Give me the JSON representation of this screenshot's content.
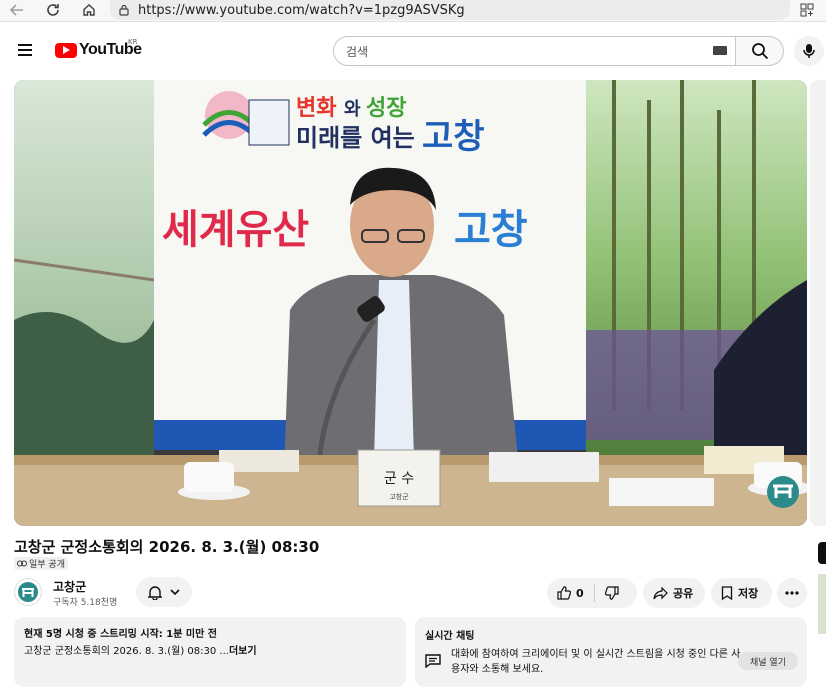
{
  "browser": {
    "url": "https://www.youtube.com/watch?v=1pzg9ASVSKg"
  },
  "header": {
    "logo_text": "YouTube",
    "country_code": "KR",
    "search_placeholder": "검색"
  },
  "video": {
    "banner_line1_a": "변화",
    "banner_line1_b": "와",
    "banner_line1_c": "성장",
    "banner_line2_a": "미래를 여는",
    "banner_line2_b": "고창",
    "slogan_part1": "세계유산",
    "slogan_part2": "고창",
    "nameplate": "군  수",
    "nameplate_sub": "고창군"
  },
  "info": {
    "title": "고창군 군정소통회의 2026. 8. 3.(월) 08:30",
    "visibility": "일부 공개"
  },
  "channel": {
    "name": "고창군",
    "subscribers": "구독자 5.18천명"
  },
  "actions": {
    "like_count": "0",
    "share_label": "공유",
    "save_label": "저장"
  },
  "description": {
    "meta": "현재 5명 시청 중  스트리밍 시작: 1분 미만 전",
    "text": "고창군 군정소통회의 2026. 8. 3.(월) 08:30 ...",
    "more": "더보기"
  },
  "chat": {
    "title": "실시간 채팅",
    "prompt": "대화에 참여하여 크리에이터 및 이 실시간 스트림을 시청 중인 다른 사용자와 소통해 보세요.",
    "open_label": "채널 열기"
  },
  "colors": {
    "brand_red": "#ff0000",
    "banner_red": "#e8342a",
    "banner_green": "#3fa535",
    "banner_blue": "#1d5fb8",
    "slogan_red": "#e02a4a",
    "slogan_orange": "#f39a1e",
    "slogan_green": "#37a84a",
    "slogan_blue": "#2a7fd4"
  }
}
